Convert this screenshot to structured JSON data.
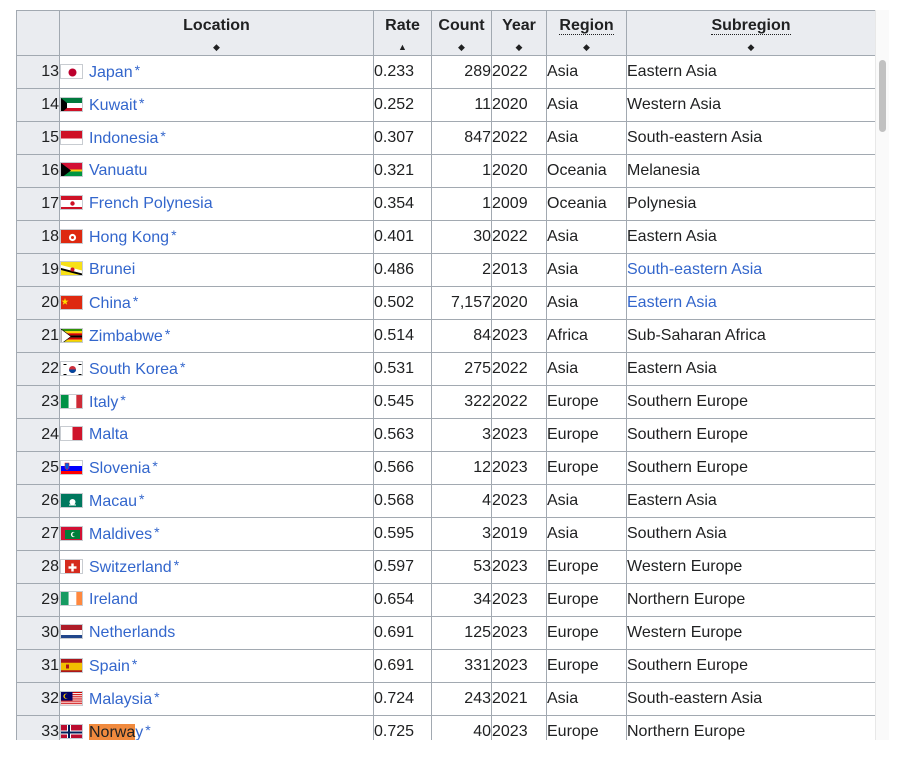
{
  "table": {
    "headers": {
      "location": "Location",
      "rate": "Rate",
      "count": "Count",
      "year": "Year",
      "region": "Region",
      "subregion": "Subregion"
    },
    "sort_icons": {
      "location": "◆",
      "rate": "▲",
      "count": "◆",
      "year": "◆",
      "region": "◆",
      "subregion": "◆"
    },
    "rows": [
      {
        "num": "13",
        "location": "Japan",
        "flag": "jp",
        "star": "*",
        "rate": "0.233",
        "count": "289",
        "year": "2022",
        "region": "Asia",
        "subregion": "Eastern Asia",
        "subregion_link": false
      },
      {
        "num": "14",
        "location": "Kuwait",
        "flag": "kw",
        "star": "*",
        "rate": "0.252",
        "count": "11",
        "year": "2020",
        "region": "Asia",
        "subregion": "Western Asia",
        "subregion_link": false
      },
      {
        "num": "15",
        "location": "Indonesia",
        "flag": "id",
        "star": "*",
        "rate": "0.307",
        "count": "847",
        "year": "2022",
        "region": "Asia",
        "subregion": "South-eastern Asia",
        "subregion_link": false
      },
      {
        "num": "16",
        "location": "Vanuatu",
        "flag": "vu",
        "star": "",
        "rate": "0.321",
        "count": "1",
        "year": "2020",
        "region": "Oceania",
        "subregion": "Melanesia",
        "subregion_link": false
      },
      {
        "num": "17",
        "location": "French Polynesia",
        "flag": "pf",
        "star": "",
        "rate": "0.354",
        "count": "1",
        "year": "2009",
        "region": "Oceania",
        "subregion": "Polynesia",
        "subregion_link": false
      },
      {
        "num": "18",
        "location": "Hong Kong",
        "flag": "hk",
        "star": "*",
        "rate": "0.401",
        "count": "30",
        "year": "2022",
        "region": "Asia",
        "subregion": "Eastern Asia",
        "subregion_link": false
      },
      {
        "num": "19",
        "location": "Brunei",
        "flag": "bn",
        "star": "",
        "rate": "0.486",
        "count": "2",
        "year": "2013",
        "region": "Asia",
        "subregion": "South-eastern Asia",
        "subregion_link": true
      },
      {
        "num": "20",
        "location": "China",
        "flag": "cn",
        "star": "*",
        "rate": "0.502",
        "count": "7,157",
        "year": "2020",
        "region": "Asia",
        "subregion": "Eastern Asia",
        "subregion_link": true
      },
      {
        "num": "21",
        "location": "Zimbabwe",
        "flag": "zw",
        "star": "*",
        "rate": "0.514",
        "count": "84",
        "year": "2023",
        "region": "Africa",
        "subregion": "Sub-Saharan Africa",
        "subregion_link": false
      },
      {
        "num": "22",
        "location": "South Korea",
        "flag": "kr",
        "star": "*",
        "rate": "0.531",
        "count": "275",
        "year": "2022",
        "region": "Asia",
        "subregion": "Eastern Asia",
        "subregion_link": false
      },
      {
        "num": "23",
        "location": "Italy",
        "flag": "it",
        "star": "*",
        "rate": "0.545",
        "count": "322",
        "year": "2022",
        "region": "Europe",
        "subregion": "Southern Europe",
        "subregion_link": false
      },
      {
        "num": "24",
        "location": "Malta",
        "flag": "mt",
        "star": "",
        "rate": "0.563",
        "count": "3",
        "year": "2023",
        "region": "Europe",
        "subregion": "Southern Europe",
        "subregion_link": false
      },
      {
        "num": "25",
        "location": "Slovenia",
        "flag": "si",
        "star": "*",
        "rate": "0.566",
        "count": "12",
        "year": "2023",
        "region": "Europe",
        "subregion": "Southern Europe",
        "subregion_link": false
      },
      {
        "num": "26",
        "location": "Macau",
        "flag": "mo",
        "star": "*",
        "rate": "0.568",
        "count": "4",
        "year": "2023",
        "region": "Asia",
        "subregion": "Eastern Asia",
        "subregion_link": false
      },
      {
        "num": "27",
        "location": "Maldives",
        "flag": "mv",
        "star": "*",
        "rate": "0.595",
        "count": "3",
        "year": "2019",
        "region": "Asia",
        "subregion": "Southern Asia",
        "subregion_link": false
      },
      {
        "num": "28",
        "location": "Switzerland",
        "flag": "ch",
        "star": "*",
        "rate": "0.597",
        "count": "53",
        "year": "2023",
        "region": "Europe",
        "subregion": "Western Europe",
        "subregion_link": false
      },
      {
        "num": "29",
        "location": "Ireland",
        "flag": "ie",
        "star": "",
        "rate": "0.654",
        "count": "34",
        "year": "2023",
        "region": "Europe",
        "subregion": "Northern Europe",
        "subregion_link": false
      },
      {
        "num": "30",
        "location": "Netherlands",
        "flag": "nl",
        "star": "",
        "rate": "0.691",
        "count": "125",
        "year": "2023",
        "region": "Europe",
        "subregion": "Western Europe",
        "subregion_link": false
      },
      {
        "num": "31",
        "location": "Spain",
        "flag": "es",
        "star": "*",
        "rate": "0.691",
        "count": "331",
        "year": "2023",
        "region": "Europe",
        "subregion": "Southern Europe",
        "subregion_link": false
      },
      {
        "num": "32",
        "location": "Malaysia",
        "flag": "my",
        "star": "*",
        "rate": "0.724",
        "count": "243",
        "year": "2021",
        "region": "Asia",
        "subregion": "South-eastern Asia",
        "subregion_link": false
      },
      {
        "num": "33",
        "location": "Norway",
        "flag": "no",
        "star": "*",
        "rate": "0.725",
        "count": "40",
        "year": "2023",
        "region": "Europe",
        "subregion": "Northern Europe",
        "subregion_link": false,
        "highlight": "Norwa",
        "rest": "y"
      }
    ]
  },
  "colors": {
    "link": "#3366cc",
    "header_bg": "#eaecf0",
    "border": "#a2a9b1",
    "highlight": "#f08a3e"
  }
}
